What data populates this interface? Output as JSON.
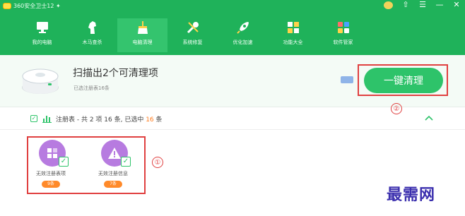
{
  "titlebar": {
    "app_title": "360安全卫士12 ✦",
    "window_controls": [
      "⇧",
      "☰",
      "—",
      "✕"
    ]
  },
  "nav": {
    "items": [
      {
        "label": "我的电脑",
        "icon": "monitor-icon",
        "active": false
      },
      {
        "label": "木马查杀",
        "icon": "horse-icon",
        "active": false
      },
      {
        "label": "电脑清理",
        "icon": "broom-icon",
        "active": true
      },
      {
        "label": "系统修复",
        "icon": "wrench-icon",
        "active": false
      },
      {
        "label": "优化加速",
        "icon": "rocket-icon",
        "active": false
      },
      {
        "label": "功能大全",
        "icon": "grid-icon",
        "active": false
      },
      {
        "label": "软件管家",
        "icon": "apps-icon",
        "active": false
      }
    ]
  },
  "scan": {
    "title": "扫描出2个可清理项",
    "subtitle": "已选注册表16条",
    "clean_button": "一键清理"
  },
  "registry": {
    "prefix": "注册表 - 共 2 项 16 条, 已选中 ",
    "selected": "16",
    "suffix": " 条"
  },
  "items": [
    {
      "label": "无效注册表项",
      "count": "9条",
      "icon": "apps-icon"
    },
    {
      "label": "无效注册信息",
      "count": "7条",
      "icon": "warning-icon"
    }
  ],
  "annotations": {
    "one": "①",
    "two": "②"
  },
  "watermark": "最需网",
  "colors": {
    "brand_green": "#1fb25a",
    "button_green": "#2ec36a",
    "accent_orange": "#ff7b1c",
    "callout_red": "#e04040",
    "item_purple": "#b77be0"
  }
}
